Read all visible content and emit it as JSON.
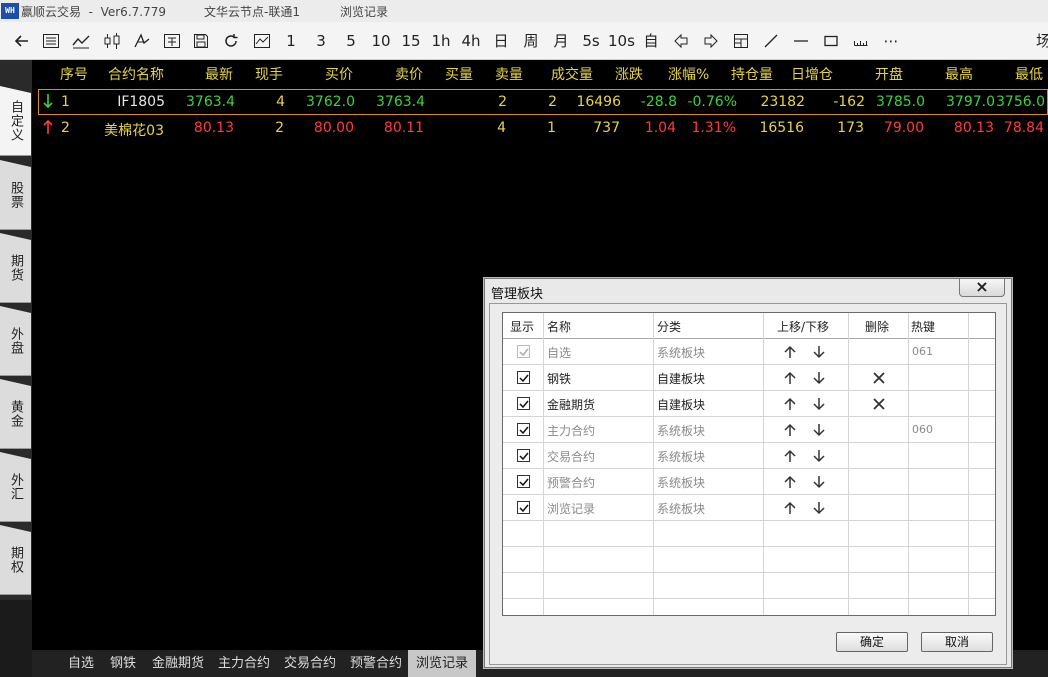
{
  "titlebar": {
    "app_name": "赢顺云交易  -  Ver6.7.779",
    "server_node": "文华云节点-联通1",
    "section": "浏览记录",
    "logo_text": "WH"
  },
  "toolbar": {
    "periods": [
      "1",
      "3",
      "5",
      "10",
      "15",
      "1h",
      "4h",
      "日",
      "周",
      "月",
      "5s",
      "10s",
      "自"
    ],
    "overflow_label": "⋯",
    "right_edge_text": "场"
  },
  "sidetabs": [
    "自定义",
    "股票",
    "期货",
    "外盘",
    "黄金",
    "外汇",
    "期权"
  ],
  "quote_table": {
    "headers": [
      "序号",
      "合约名称",
      "最新",
      "现手",
      "买价",
      "卖价",
      "买量",
      "卖量",
      "成交量",
      "涨跌",
      "涨幅%",
      "持仓量",
      "日增仓",
      "开盘",
      "最高",
      "最低"
    ],
    "rows": [
      {
        "direction": "down",
        "direction_color": "#3fd13f",
        "index": "1",
        "name": "IF1805",
        "last": "3763.4",
        "cur_vol": "4",
        "bid": "3762.0",
        "ask": "3763.4",
        "bid_vol": "2",
        "ask_vol": "2",
        "volume": "16496",
        "change": "-28.8",
        "change_pct": "-0.76%",
        "open_interest": "23182",
        "oi_change": "-162",
        "open": "3785.0",
        "high": "3797.0",
        "low": "3756.0"
      },
      {
        "direction": "up",
        "direction_color": "#ff3b3b",
        "index": "2",
        "name": "美棉花03",
        "last": "80.13",
        "cur_vol": "2",
        "bid": "80.00",
        "ask": "80.11",
        "bid_vol": "4",
        "ask_vol": "1",
        "volume": "737",
        "change": "1.04",
        "change_pct": "1.31%",
        "open_interest": "16516",
        "oi_change": "173",
        "open": "79.00",
        "high": "80.13",
        "low": "78.84"
      }
    ]
  },
  "bottom_tabs": [
    "自选",
    "钢铁",
    "金融期货",
    "主力合约",
    "交易合约",
    "预警合约",
    "浏览记录"
  ],
  "active_bottom_tab": "浏览记录",
  "dialog": {
    "title": "管理板块",
    "close_label": "×",
    "columns": [
      "显示",
      "名称",
      "分类",
      "上移/下移",
      "删除",
      "热键"
    ],
    "rows": [
      {
        "checked": true,
        "disabled": true,
        "name": "自选",
        "category": "系统板块",
        "deletable": false,
        "hotkey": "061"
      },
      {
        "checked": true,
        "disabled": false,
        "name": "钢铁",
        "category": "自建板块",
        "deletable": true,
        "hotkey": ""
      },
      {
        "checked": true,
        "disabled": false,
        "name": "金融期货",
        "category": "自建板块",
        "deletable": true,
        "hotkey": ""
      },
      {
        "checked": true,
        "disabled": false,
        "name": "主力合约",
        "category": "系统板块",
        "deletable": false,
        "hotkey": "060"
      },
      {
        "checked": true,
        "disabled": false,
        "name": "交易合约",
        "category": "系统板块",
        "deletable": false,
        "hotkey": ""
      },
      {
        "checked": true,
        "disabled": false,
        "name": "预警合约",
        "category": "系统板块",
        "deletable": false,
        "hotkey": ""
      },
      {
        "checked": true,
        "disabled": false,
        "name": "浏览记录",
        "category": "系统板块",
        "deletable": false,
        "hotkey": ""
      }
    ],
    "ok_label": "确定",
    "cancel_label": "取消"
  },
  "colors": {
    "header_text": "#e5d34a",
    "up": "#ff3b3b",
    "down": "#3fd13f",
    "selection_border": "#d98a2c"
  }
}
